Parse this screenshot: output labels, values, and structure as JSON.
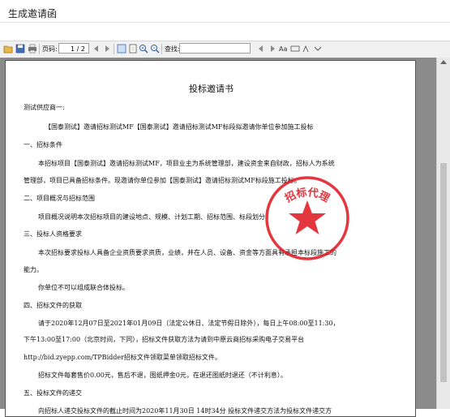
{
  "window": {
    "title": "生成邀请函"
  },
  "toolbar": {
    "page_label": "页码:",
    "page_value": "1 / 2",
    "find_label": "查找:"
  },
  "doc": {
    "title": "投标邀请书",
    "lines": [
      "测试供应商一:",
      "【国泰测试】邀请招标测试MF【国泰测试】邀请招标测试MF标段拟邀请你单位参加施工投标",
      "一、招标条件",
      "本招标项目【国泰测试】邀请招标测试MF，项目业主为系统管理部，建设资金来自财政，招标人为系统",
      "管理部，项目已具备招标条件。现邀请你单位参加【国泰测试】邀请招标测试MF标段施工投标。",
      "二、项目概况与招标范围",
      "项目概况说明本次招标项目的建设地点、规模、计划工期、招标范围、标段划分",
      "三、投标人资格要求",
      "本次招标要求投标人具备企业资质要求资质，业绩，并在人员、设备、资金等方面具有承担本标段施工的",
      "能力。",
      "你单位不可以组成联合体投标。",
      "四、招标文件的获取",
      "请于2020年12月07日至2021年01月09日（法定公休日、法定节假日除外），每日上午08:00至11:30，",
      "下午13:00至17:00（北京时间，下同），招标文件获取方法为请到中原云商招标采购电子交易平台",
      "http://bid.zyepp.com/TPBidder招标文件领取菜单领取招标文件。",
      "招标文件每套售价0.00元，售后不退，图纸押金0元，在退还图纸时退还（不计利息）。",
      "五、投标文件的递交",
      "向招标人递交投标文件的截止时间为2020年11月30日 14时34分 投标文件递交方法为投标文件递交方"
    ],
    "stamp_text": "招标代理",
    "stamp_color": "#e0141e"
  }
}
